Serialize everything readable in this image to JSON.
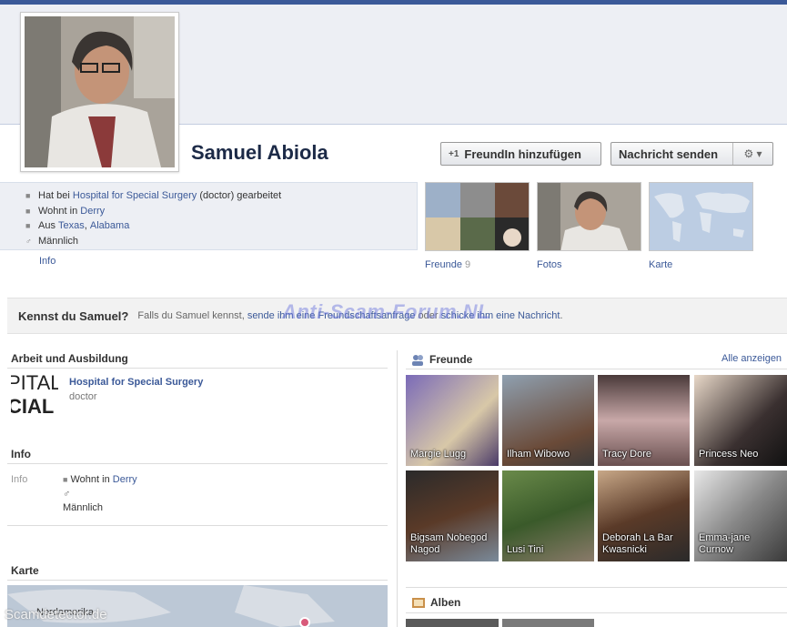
{
  "profile": {
    "name": "Samuel Abiola",
    "add_friend_label": "FreundIn hinzufügen",
    "message_label": "Nachricht senden"
  },
  "intro": {
    "work": {
      "prefix": "Hat bei",
      "employer": "Hospital for Special Surgery",
      "suffix": "(doctor) gearbeitet"
    },
    "lives": {
      "prefix": "Wohnt in",
      "place": "Derry"
    },
    "from": {
      "prefix": "Aus",
      "city": "Texas",
      "sep": ",",
      "state": "Alabama"
    },
    "gender": "Männlich",
    "info_link": "Info"
  },
  "thumbs": {
    "friends_label": "Freunde",
    "friends_count": "9",
    "photos_label": "Fotos",
    "map_label": "Karte"
  },
  "know_bar": {
    "question": "Kennst du Samuel?",
    "text_prefix": "Falls du Samuel kennst,",
    "request_link": "sende ihm eine Freundschaftsanfrage",
    "or": "oder",
    "message_link": "schicke ihm eine Nachricht",
    "end": "."
  },
  "watermark": "Anti-Scam-Forum.NL",
  "work_section": {
    "title": "Arbeit und Ausbildung",
    "logo_text_1": "PITAL",
    "logo_text_2": "CIAL S",
    "employer": "Hospital for Special Surgery",
    "position": "doctor"
  },
  "info_section": {
    "title": "Info",
    "label": "Info",
    "lives_prefix": "Wohnt in",
    "lives_place": "Derry",
    "gender": "Männlich"
  },
  "map_section": {
    "title": "Karte",
    "map_label": "Nordamerika"
  },
  "friends_section": {
    "title": "Freunde",
    "see_all": "Alle anzeigen",
    "items": [
      {
        "name": "Margie Lugg"
      },
      {
        "name": "Ilham Wibowo"
      },
      {
        "name": "Tracy Dore"
      },
      {
        "name": "Princess Neo"
      },
      {
        "name": "Bigsam Nobegod Nagod"
      },
      {
        "name": "Lusi Tini"
      },
      {
        "name": "Deborah La Bar Kwasnicki"
      },
      {
        "name": "Emma-jane Curnow"
      }
    ]
  },
  "albums_section": {
    "title": "Alben"
  },
  "bottom_watermark": "Scamdetector.de",
  "colors": {
    "brand": "#3b5998",
    "cover_bg": "#edeff4",
    "name_color": "#1c2a47"
  }
}
